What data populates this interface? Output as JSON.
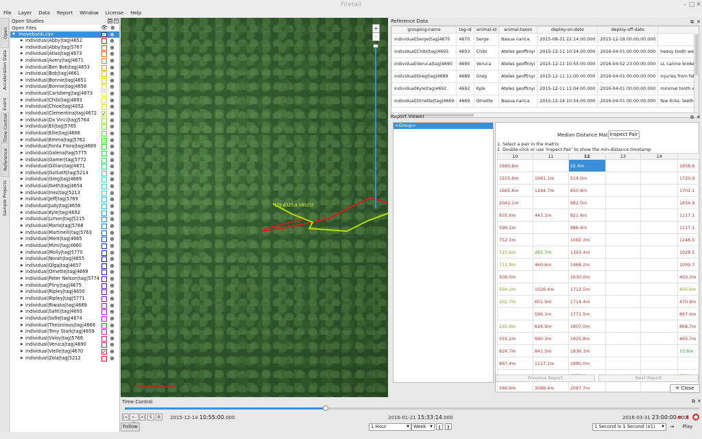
{
  "window": {
    "title": "Firetail"
  },
  "menu": [
    "File",
    "Layer",
    "Data",
    "Report",
    "Window",
    "License",
    "Help"
  ],
  "side_tabs": [
    "Open Studies",
    "Acceleration Data",
    "Event Data",
    "Time Control",
    "Reference Data",
    "Sample Projects"
  ],
  "open_studies": {
    "title": "Open Studies",
    "open_files_label": "Open Files",
    "file": "movebank.csv",
    "individuals": [
      {
        "name": "individual|Abby|tag|4652",
        "color": "#ff0000",
        "checked": false
      },
      {
        "name": "individual|Abby|tag|5767",
        "color": "#ff3a00",
        "checked": false
      },
      {
        "name": "individual|Atlas|tag|4673",
        "color": "#ff5a00",
        "checked": false
      },
      {
        "name": "individual|Avery|tag|4671",
        "color": "#ff7a00",
        "checked": false
      },
      {
        "name": "individual|Ben Bob|tag|4653",
        "color": "#ff9500",
        "checked": false
      },
      {
        "name": "individual|Bob|tag|4661",
        "color": "#ffb000",
        "checked": false
      },
      {
        "name": "individual|Bonnie|tag|4651",
        "color": "#ffc800",
        "checked": false
      },
      {
        "name": "individual|Bonnie|tag|4658",
        "color": "#ffdd00",
        "checked": false
      },
      {
        "name": "individual|Carlsberg|tag|4673",
        "color": "#f0f000",
        "checked": false
      },
      {
        "name": "individual|Chibi|tag|4693",
        "color": "#dff000",
        "checked": false
      },
      {
        "name": "individual|Chloe|tag|4052",
        "color": "#c8f000",
        "checked": false
      },
      {
        "name": "individual|Clementina|tag|4672",
        "color": "#b0f000",
        "checked": true
      },
      {
        "name": "individual|Da Vinci|tag|5764",
        "color": "#90f000",
        "checked": false
      },
      {
        "name": "individual|Eli|tag|5765",
        "color": "#70f000",
        "checked": false
      },
      {
        "name": "individual|Ellie|tag|4668",
        "color": "#50f000",
        "checked": false
      },
      {
        "name": "individual|Emma|tag|5762",
        "color": "#30f000",
        "checked": false
      },
      {
        "name": "individual|Fonta Flora|tag|4689",
        "color": "#10f010",
        "checked": false
      },
      {
        "name": "individual|Galena|tag|5775",
        "color": "#00f030",
        "checked": false
      },
      {
        "name": "individual|Gamer|tag|5772",
        "color": "#00f050",
        "checked": false
      },
      {
        "name": "individual|Gillian|tag|4671",
        "color": "#00f070",
        "checked": false
      },
      {
        "name": "individual|Golliath|tag|5214",
        "color": "#00f090",
        "checked": false
      },
      {
        "name": "individual|Greg|tag|4689",
        "color": "#00f0b0",
        "checked": false
      },
      {
        "name": "individual|Ibeth|tag|4654",
        "color": "#00f0d0",
        "checked": false
      },
      {
        "name": "individual|Inez|tag|5213",
        "color": "#00f0f0",
        "checked": false
      },
      {
        "name": "individual|Jeff|tag|5769",
        "color": "#00d8f0",
        "checked": false
      },
      {
        "name": "individual|Judy|tag|4656",
        "color": "#00c0f0",
        "checked": false
      },
      {
        "name": "individual|Kyle|tag|4692",
        "color": "#00a8f0",
        "checked": false
      },
      {
        "name": "individual|Limon|tag|5215",
        "color": "#0090f0",
        "checked": false
      },
      {
        "name": "individual|Mario|tag|5768",
        "color": "#0078f0",
        "checked": false
      },
      {
        "name": "individual|Martinelli|tag|5763",
        "color": "#0060f0",
        "checked": false
      },
      {
        "name": "individual|Merk|tag|4665",
        "color": "#0048f0",
        "checked": false
      },
      {
        "name": "individual|Mimi|tag|4660",
        "color": "#0030f0",
        "checked": false
      },
      {
        "name": "individual|Molly|tag|5770",
        "color": "#0018f0",
        "checked": false
      },
      {
        "name": "individual|Norah|tag|4655",
        "color": "#0000f0",
        "checked": false
      },
      {
        "name": "individual|Olga|tag|4657",
        "color": "#1800f0",
        "checked": false
      },
      {
        "name": "individual|Ornette|tag|4669",
        "color": "#3000f0",
        "checked": false
      },
      {
        "name": "individual|Peter Nelson|tag|5774",
        "color": "#4800f0",
        "checked": false
      },
      {
        "name": "individual|Pliny|tag|4675",
        "color": "#6000f0",
        "checked": false
      },
      {
        "name": "individual|Ripley|tag|4650",
        "color": "#7800f0",
        "checked": false
      },
      {
        "name": "individual|Ripley|tag|5771",
        "color": "#9000f0",
        "checked": false
      },
      {
        "name": "individual|Riwaka|tag|4669",
        "color": "#a800f0",
        "checked": false
      },
      {
        "name": "individual|Sahti|tag|4693",
        "color": "#c000f0",
        "checked": false
      },
      {
        "name": "individual|Sofie|tag|4674",
        "color": "#d800f0",
        "checked": false
      },
      {
        "name": "individual|Thelonious|tag|4668",
        "color": "#f000f0",
        "checked": false
      },
      {
        "name": "individual|Tony Stark|tag|4659",
        "color": "#f000c0",
        "checked": false
      },
      {
        "name": "individual|Valoy|tag|5766",
        "color": "#f00090",
        "checked": false
      },
      {
        "name": "individual|Veruca|tag|4690",
        "color": "#f00060",
        "checked": false
      },
      {
        "name": "individual|Vielle|tag|4670",
        "color": "#f00030",
        "checked": true
      },
      {
        "name": "individual|Zola|tag|5212",
        "color": "#f00010",
        "checked": false
      }
    ]
  },
  "map": {
    "zoom_in": "+",
    "zoom_out": "-",
    "track_label": "[79.8323.9.18023]"
  },
  "reference_data": {
    "title": "Reference Data",
    "columns": [
      "grouping-name",
      "tag-id",
      "animal-id",
      "animal-taxon",
      "deploy-on-date",
      "deploy-off-date",
      ""
    ],
    "rows": [
      [
        "individual|Serge|tag|4670",
        "4670",
        "Serge",
        "Nasua narica",
        "2015-08-31 22:14:00.000",
        "2015-12-18 00:00:00.000",
        ""
      ],
      [
        "individual|Chibi|tag|4693",
        "4693",
        "Chibi",
        "Ateles geoffroyi",
        "2015-12-11 10:54:00.000",
        "2016-04-01 00:00:00.000",
        "heavy tooth wear, 1 L in"
      ],
      [
        "individual|Veruca|tag|4690",
        "4690",
        "Veruca",
        "Ateles geoffroyi",
        "2015-12-11 10:55:00.000",
        "2016-04-02 23:00:00.000",
        "LL canine broken"
      ],
      [
        "individual|Greg|tag|4689",
        "4689",
        "Greg",
        "Ateles geoffroyi",
        "2015-12-11 11:00:00.000",
        "2016-04-01 00:00:00.000",
        "injuries from fall: 1.5cm"
      ],
      [
        "individual|Kyle|tag|4692",
        "4692",
        "Kyle",
        "Ateles geoffroyi",
        "2015-12-11 11:04:00.000",
        "2016-04-01 00:00:00.000",
        "minimal tooth wear."
      ],
      [
        "individual|Ornette|tag|4669",
        "4669",
        "Ornette",
        "Nasua narica",
        "2015-12-14 10:54:00.000",
        "2016-04-01 00:00:00.000",
        "few ticks. teeth good."
      ]
    ]
  },
  "report_viewer": {
    "title": "Report Viewer",
    "group_item": "<Group>",
    "matrix_title": "Median Distance Matrix",
    "inspect_button": "Inspect Pair",
    "instruction_1": "1. Select a pair in the matrix",
    "instruction_2": "2. Double-click or use 'Inspect Pair' to show the min-distance timstamp",
    "columns": [
      "10",
      "11",
      "12",
      "13",
      "14",
      ""
    ],
    "sorted_column": "12",
    "rows": [
      [
        "1660.8m",
        "",
        "15.4m",
        "",
        "",
        "1858.6"
      ],
      [
        "1555.9m",
        "1061.1m",
        "514.0m",
        "",
        "",
        "1720.9"
      ],
      [
        "1665.6m",
        "1294.7m",
        "650.8m",
        "",
        "",
        "1702.1"
      ],
      [
        "2042.1m",
        "",
        "682.0m",
        "",
        "",
        "1834.9"
      ],
      [
        "835.6m",
        "443.1m",
        "921.6m",
        "",
        "",
        "1117.1"
      ],
      [
        "596.1m",
        "",
        "986.4m",
        "",
        "",
        "1117.1"
      ],
      [
        "752.1m",
        "",
        "1082.3m",
        "",
        "",
        "1246.5"
      ],
      [
        "725.6m",
        "265.7m",
        "1393.4m",
        "",
        "",
        "1028.5"
      ],
      [
        "711.9m",
        "460.6m",
        "1469.2m",
        "",
        "",
        "1009.7"
      ],
      [
        "509.0m",
        "",
        "1630.0m",
        "",
        "",
        "493.2m"
      ],
      [
        "594.2m",
        "1026.4m",
        "1712.5m",
        "",
        "",
        "405.6m"
      ],
      [
        "202.7m",
        "601.9m",
        "1714.4m",
        "",
        "",
        "470.8m"
      ],
      [
        "",
        "596.1m",
        "1771.5m",
        "",
        "",
        "867.4m"
      ],
      [
        "235.4m",
        "626.9m",
        "1807.0m",
        "",
        "",
        "866.7m"
      ],
      [
        "555.2m",
        "990.3m",
        "1825.8m",
        "",
        "",
        "465.7m"
      ],
      [
        "826.7m",
        "841.5m",
        "1836.3m",
        "",
        "",
        "33.8m"
      ],
      [
        "867.4m",
        "1117.1m",
        "1880.0m",
        "",
        "",
        ""
      ],
      [
        "",
        "",
        "2032.3m",
        "",
        "",
        "279.0m"
      ],
      [
        "566.6m",
        "3088.4m",
        "2087.7m",
        "",
        "",
        "972.5m"
      ]
    ],
    "prev_button": "Previous Report",
    "next_button": "Next Report",
    "close_button": "Close"
  },
  "time_control": {
    "title": "Time Control",
    "progress": 0.35,
    "start_date": "2015-12-14",
    "start_time": "10:55:00",
    "start_ms": ".000",
    "current_date": "2016-01-21",
    "current_time": "15:33:14",
    "current_ms": ".000",
    "end_date": "2016-03-31",
    "end_time": "23:00:00",
    "end_ms": ".000",
    "step_select": "1 Hour",
    "window_select": "Week",
    "speed_select": "1 Second is 1 Second (x1)",
    "follow_button": "Follow",
    "play_button": "Play",
    "btn_prev": "|<",
    "btn_range": "<->",
    "btn_next": ">|",
    "btn_s": "S",
    "btn_b": "B"
  }
}
